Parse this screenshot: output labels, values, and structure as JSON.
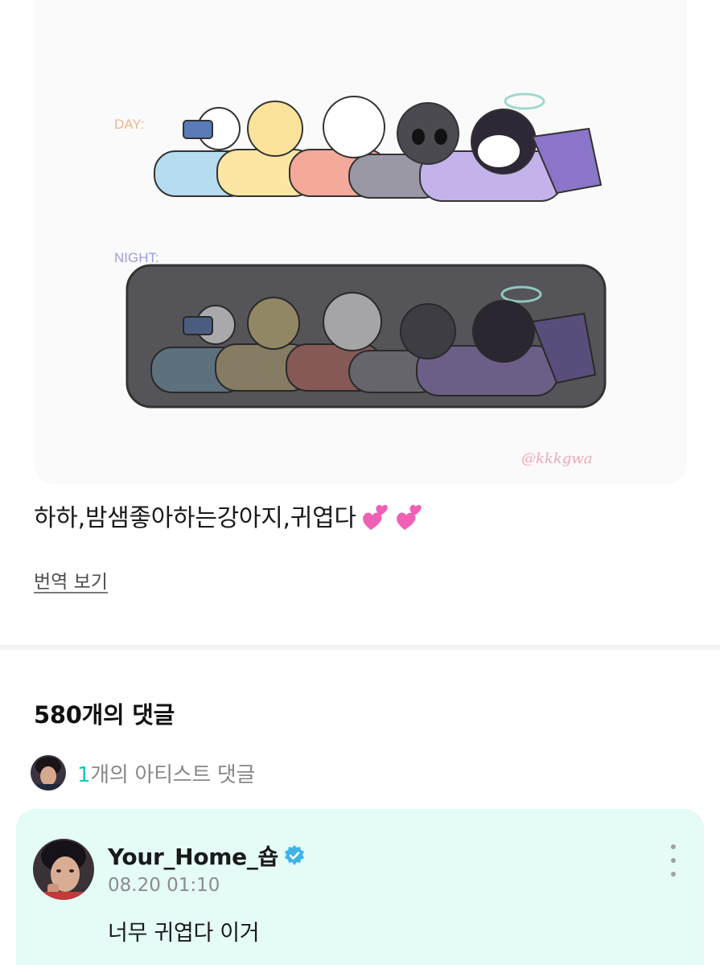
{
  "post": {
    "image": {
      "day_label": "DAY:",
      "night_label": "NIGHT:",
      "signature": "@kkkgwa"
    },
    "text": "하하,밤샘좋아하는강아지,귀엽다",
    "hearts_icon": "two-hearts-emoji",
    "translate_label": "번역 보기"
  },
  "comments": {
    "title": "580개의 댓글",
    "artist_count": "1",
    "artist_label": "개의 아티스트 댓글"
  },
  "featured_comment": {
    "author": "Your_Home_숍",
    "verified_icon": "verified-badge-icon",
    "timestamp": "08.20 01:10",
    "body": "너무 귀엽다 이거",
    "card_color": "#e4fbf6"
  },
  "colors": {
    "accent": "#10c8bf",
    "verified": "#3fb3e8"
  }
}
